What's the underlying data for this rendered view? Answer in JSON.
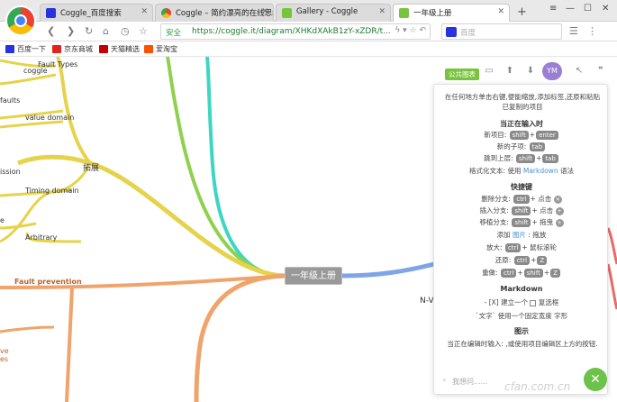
{
  "browser": {
    "tabs": [
      {
        "title": "Coggle_百度搜索",
        "active": false,
        "color": "#2932e1"
      },
      {
        "title": "Coggle – 简约漂亮的在线思维导图",
        "active": false,
        "color": "#4285f4"
      },
      {
        "title": "Gallery - Coggle",
        "active": false,
        "color": "#78c43c"
      },
      {
        "title": "一年级上册",
        "active": true,
        "color": "#78c43c"
      }
    ],
    "secure_label": "安全",
    "url": "https://coggle.it/diagram/XHKdXAkB1zY-xZDR/t...",
    "search_placeholder": "百度"
  },
  "bookmarks": [
    {
      "label": "百度一下",
      "color": "#2932e1"
    },
    {
      "label": "京东商城",
      "color": "#e1251b"
    },
    {
      "label": "天猫精选",
      "color": "#c40000"
    },
    {
      "label": "爱淘宝",
      "color": "#ff5000"
    }
  ],
  "mindmap": {
    "root": "一年级上册",
    "nodes": [
      {
        "id": "fault-types",
        "text": "Fault Types",
        "color": "#666"
      },
      {
        "id": "coggle",
        "text": "coggle",
        "color": "#666"
      },
      {
        "id": "faults",
        "text": "faults",
        "color": "#666"
      },
      {
        "id": "value-domain",
        "text": "value domain",
        "color": "#666"
      },
      {
        "id": "tuozhan",
        "text": "拓展",
        "color": "#555"
      },
      {
        "id": "ission",
        "text": "ission",
        "color": "#666"
      },
      {
        "id": "timing-domain",
        "text": "Timing domain",
        "color": "#666"
      },
      {
        "id": "e-node",
        "text": "e",
        "color": "#666"
      },
      {
        "id": "arbitrary",
        "text": "Arbitrary",
        "color": "#666"
      },
      {
        "id": "fault-prevention",
        "text": "Fault prevention",
        "color": "#b8632f"
      },
      {
        "id": "ve",
        "text": "ve",
        "color": "#b8632f"
      },
      {
        "id": "es",
        "text": "es",
        "color": "#b8632f"
      },
      {
        "id": "nv",
        "text": "N-V",
        "color": "#555"
      }
    ]
  },
  "toolbar": {
    "public_tag": "公共图表",
    "user_initials": "YM"
  },
  "help": {
    "intro": "在任何地方单击右键,便能缩放,添加标签,还原和粘贴已复制的项目",
    "section_input": "当正在输入时",
    "new_item": "新项目:",
    "new_child": "新的子项:",
    "jump_up": "跳到上层:",
    "format_text": "格式化文本: 使用",
    "markdown_link": "Markdown",
    "grammar": "语法",
    "section_shortcuts": "快捷键",
    "delete_branch": "删除分支:",
    "insert_branch": "插入分支:",
    "move_branch": "移植分支:",
    "add_image": "添加",
    "image_link": "图片",
    "drag": ": 拖放",
    "zoom": "放大:",
    "undo": "还原:",
    "redo": "重做:",
    "click": "+ 点击",
    "drag2": "+ 拖曳",
    "wheel": "+ 鼠标滚轮",
    "section_markdown": "Markdown",
    "md_checkbox": "- [X] 建立一个",
    "md_checkbox_tail": "复选框",
    "md_code": "`文字` 使用一个固定宽度 字形",
    "section_diagram": "图示",
    "diagram_text": "当正在编辑时输入: ,或使用项目编辑区上方的按钮.",
    "key_shift": "shift",
    "key_enter": "enter",
    "key_tab": "tab",
    "key_ctrl": "ctrl",
    "key_z": "Z",
    "search_placeholder": "我想问......"
  },
  "watermark": "cfan.com.cn"
}
